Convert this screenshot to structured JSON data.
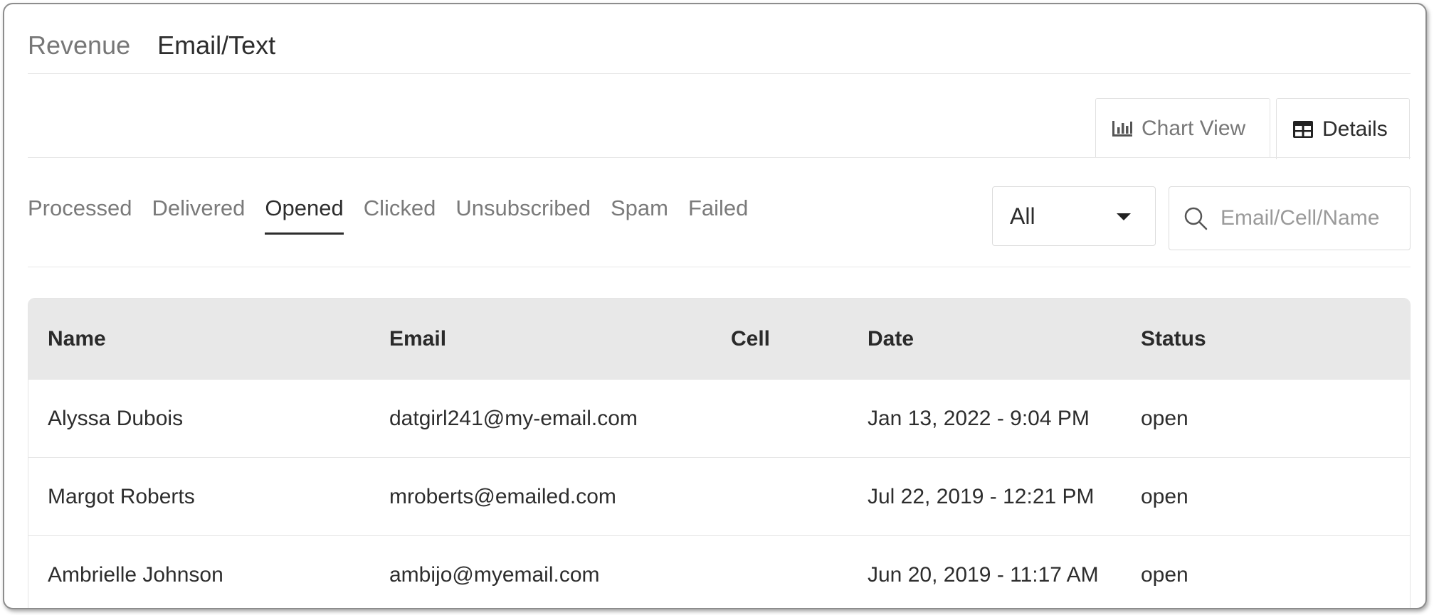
{
  "top_tabs": [
    {
      "label": "Revenue",
      "active": false
    },
    {
      "label": "Email/Text",
      "active": true
    }
  ],
  "view_tabs": {
    "chart_view": {
      "label": "Chart View",
      "icon": "bar-chart-icon"
    },
    "details": {
      "label": "Details",
      "icon": "table-grid-icon",
      "active": true
    }
  },
  "status_tabs": [
    {
      "label": "Processed"
    },
    {
      "label": "Delivered"
    },
    {
      "label": "Opened",
      "active": true
    },
    {
      "label": "Clicked"
    },
    {
      "label": "Unsubscribed"
    },
    {
      "label": "Spam"
    },
    {
      "label": "Failed"
    }
  ],
  "filter": {
    "selected": "All"
  },
  "search": {
    "placeholder": "Email/Cell/Name",
    "value": "",
    "icon": "search-icon"
  },
  "table": {
    "columns": [
      "Name",
      "Email",
      "Cell",
      "Date",
      "Status"
    ],
    "rows": [
      {
        "name": "Alyssa Dubois",
        "email": "datgirl241@my-email.com",
        "cell": "",
        "date": "Jan 13, 2022 - 9:04 PM",
        "status": "open"
      },
      {
        "name": "Margot Roberts",
        "email": "mroberts@emailed.com",
        "cell": "",
        "date": "Jul 22, 2019 - 12:21 PM",
        "status": "open"
      },
      {
        "name": "Ambrielle Johnson",
        "email": "ambijo@myemail.com",
        "cell": "",
        "date": "Jun 20, 2019 - 11:17 AM",
        "status": "open"
      }
    ]
  },
  "colors": {
    "active_text": "#2d2d2d",
    "inactive_text": "#777777",
    "header_bg": "#e8e8e8"
  }
}
